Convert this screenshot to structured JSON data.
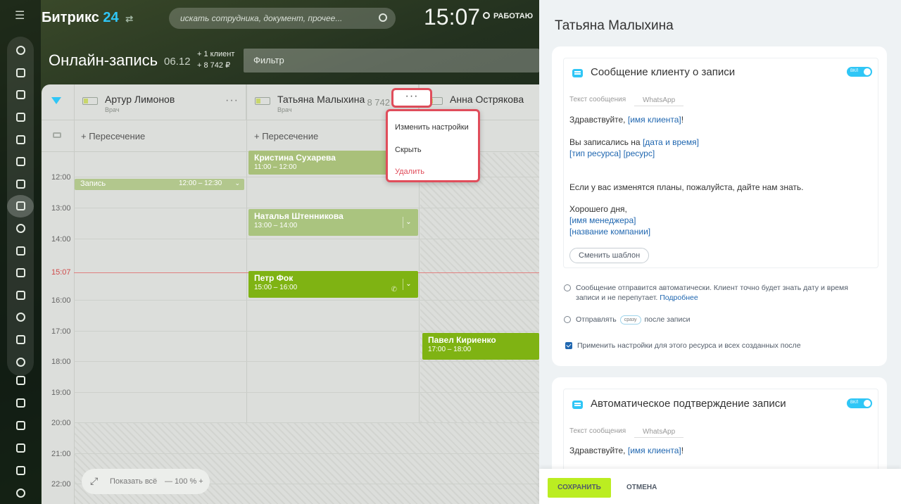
{
  "header": {
    "logo_text": "Битрикс",
    "logo_num": "24",
    "search_placeholder": "искать сотрудника, документ, прочее...",
    "clock": "15:07",
    "work_status": "РАБОТАЮ"
  },
  "page": {
    "title": "Онлайн-запись",
    "date": "06.12",
    "stat_clients": "+ 1 клиент",
    "stat_sum": "+ 8 742 ₽",
    "filter_placeholder": "Фильтр"
  },
  "columns": [
    {
      "name": "Артур Лимонов",
      "role": "Врач"
    },
    {
      "name": "Татьяна Малыхина",
      "role": "Врач",
      "sum": "8 742"
    },
    {
      "name": "Анна Острякова"
    }
  ],
  "overlap_label": "+ Пересечение",
  "time_labels": [
    "12:00",
    "13:00",
    "14:00",
    "15:07",
    "16:00",
    "17:00",
    "18:00",
    "19:00",
    "20:00",
    "21:00",
    "22:00"
  ],
  "events": [
    {
      "name": "Кристина Сухарева",
      "time": "11:00 – 12:00"
    },
    {
      "name": "Запись",
      "time": "12:00 – 12:30"
    },
    {
      "name": "Наталья Штенникова",
      "time": "13:00 – 14:00"
    },
    {
      "name": "Петр Фок",
      "time": "15:00 – 16:00"
    },
    {
      "name": "Павел Кириенко",
      "time": "17:00 – 18:00"
    }
  ],
  "zoom": {
    "show_all": "Показать всё",
    "percent": "— 100 % +"
  },
  "context_menu": {
    "dots": "···",
    "items": [
      "Изменить настройки",
      "Скрыть",
      "Удалить"
    ]
  },
  "panel": {
    "title": "Татьяна Малыхина",
    "card1": {
      "heading": "Сообщение клиенту о записи",
      "toggle_label": "ВКЛ",
      "msg_label": "Текст сообщения",
      "channel": "WhatsApp",
      "greeting": "Здравствуйте,",
      "ph_client": "[имя клиента]",
      "excl": "!",
      "booked": "Вы записались на",
      "ph_datetime": "[дата и время]",
      "ph_restype": "[тип ресурса]",
      "ph_resource": "[ресурс]",
      "plans": "Если у вас изменятся планы, пожалуйста, дайте нам знать.",
      "bye": "Хорошего дня,",
      "ph_manager": "[имя менеджера]",
      "ph_company": "[название компании]",
      "change_template": "Сменить шаблон",
      "note": "Сообщение отправится автоматически. Клиент точно будет знать дату и время записи и не перепутает.",
      "more_link": "Подробнее",
      "send_prefix": "Отправлять",
      "send_chip": "сразу",
      "send_suffix": "после записи",
      "apply_label": "Применить настройки для этого ресурса и всех созданных после"
    },
    "card2": {
      "heading": "Автоматическое подтверждение записи",
      "toggle_label": "ВКЛ",
      "msg_label": "Текст сообщения",
      "channel": "WhatsApp",
      "greeting": "Здравствуйте,",
      "ph_client": "[имя клиента]",
      "excl": "!"
    },
    "save": "СОХРАНИТЬ",
    "cancel": "ОТМЕНА"
  },
  "colors": {
    "accent": "#2fc6f6",
    "event_green": "#7fb313",
    "danger": "#e04d5b",
    "save_green": "#bbed21"
  }
}
